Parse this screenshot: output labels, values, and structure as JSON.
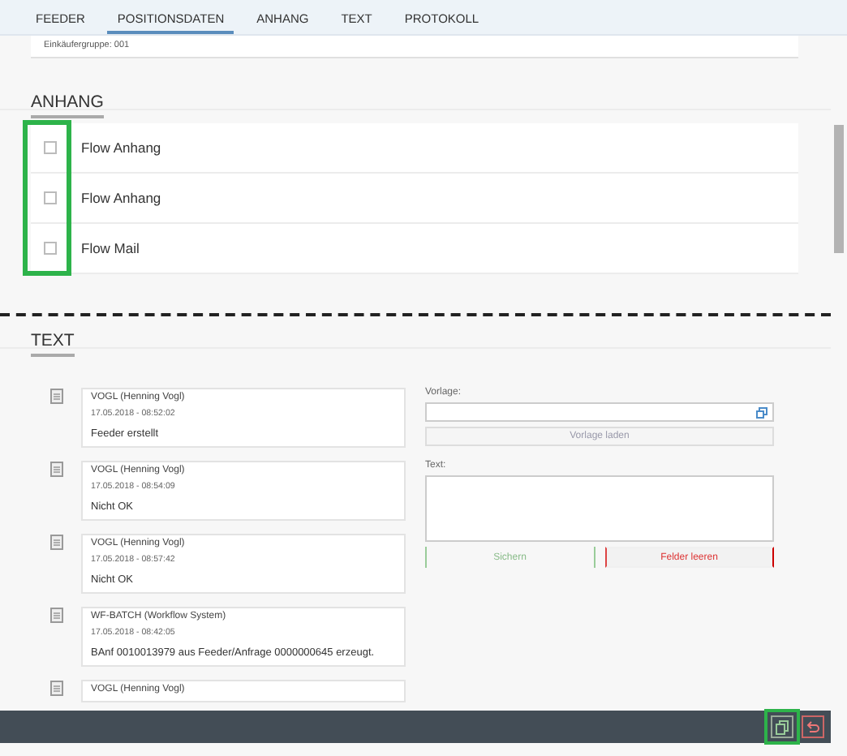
{
  "tabs": [
    {
      "label": "FEEDER",
      "selected": false
    },
    {
      "label": "POSITIONSDATEN",
      "selected": true
    },
    {
      "label": "ANHANG",
      "selected": false
    },
    {
      "label": "TEXT",
      "selected": false
    },
    {
      "label": "PROTOKOLL",
      "selected": false
    }
  ],
  "purchaser_group": {
    "label": "Einkäufergruppe:",
    "value": "001"
  },
  "attachments": {
    "title": "ANHANG",
    "items": [
      {
        "label": "Flow Anhang",
        "checked": false
      },
      {
        "label": "Flow Anhang",
        "checked": false
      },
      {
        "label": "Flow Mail",
        "checked": false
      }
    ]
  },
  "text_section": {
    "title": "TEXT",
    "entries": [
      {
        "author": "VOGL (Henning Vogl)",
        "time": "17.05.2018 - 08:52:02",
        "text": "Feeder erstellt"
      },
      {
        "author": "VOGL (Henning Vogl)",
        "time": "17.05.2018 - 08:54:09",
        "text": "Nicht OK"
      },
      {
        "author": "VOGL (Henning Vogl)",
        "time": "17.05.2018 - 08:57:42",
        "text": "Nicht OK"
      },
      {
        "author": "WF-BATCH (Workflow System)",
        "time": "17.05.2018 - 08:42:05",
        "text": "BAnf 0010013979 aus Feeder/Anfrage 0000000645 erzeugt."
      },
      {
        "author": "VOGL (Henning Vogl)"
      }
    ],
    "template_label": "Vorlage:",
    "load_button": "Vorlage laden",
    "text_label": "Text:",
    "save_button": "Sichern",
    "clear_button": "Felder leeren"
  }
}
